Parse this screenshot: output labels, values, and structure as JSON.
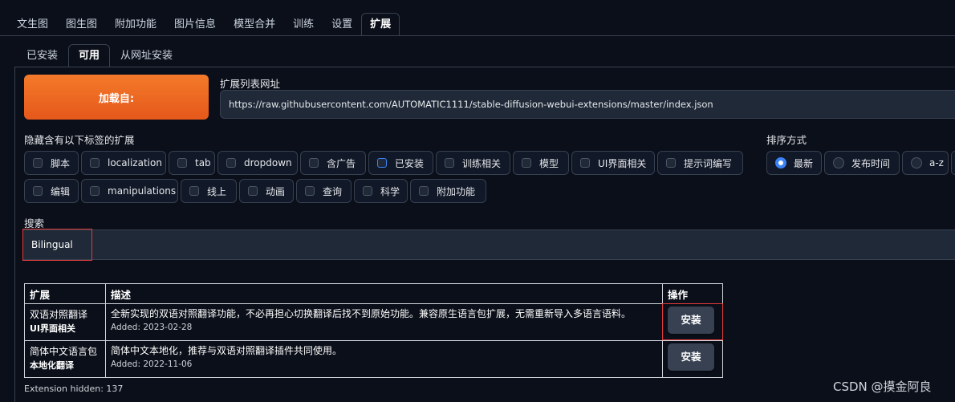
{
  "top_tabs": [
    "文生图",
    "图生图",
    "附加功能",
    "图片信息",
    "模型合并",
    "训练",
    "设置",
    "扩展"
  ],
  "sub_tabs": [
    "已安装",
    "可用",
    "从网址安装"
  ],
  "load_button": "加载自:",
  "url_label": "扩展列表网址",
  "url_value": "https://raw.githubusercontent.com/AUTOMATIC1111/stable-diffusion-webui-extensions/master/index.json",
  "hide_label": "隐藏含有以下标签的扩展",
  "tags": [
    "脚本",
    "localization",
    "tab",
    "dropdown",
    "含广告",
    "已安装",
    "训练相关",
    "模型",
    "UI界面相关",
    "提示词编写",
    "编辑",
    "manipulations",
    "线上",
    "动画",
    "查询",
    "科学",
    "附加功能"
  ],
  "sort_label": "排序方式",
  "sort_options": [
    "最新",
    "发布时间",
    "a-z"
  ],
  "search_label": "搜索",
  "search_value": "Bilingual",
  "table": {
    "headers": [
      "扩展",
      "描述",
      "操作"
    ],
    "rows": [
      {
        "name": "双语对照翻译",
        "tag": "UI界面相关",
        "desc": "全新实现的双语对照翻译功能，不必再担心切换翻译后找不到原始功能。兼容原生语言包扩展，无需重新导入多语言语料。",
        "added": "Added: 2023-02-28",
        "action": "安装"
      },
      {
        "name": "简体中文语言包",
        "tag": "本地化翻译",
        "desc": "简体中文本地化，推荐与双语对照翻译插件共同使用。",
        "added": "Added: 2022-11-06",
        "action": "安装"
      }
    ]
  },
  "hidden_count": "Extension hidden: 137",
  "watermark": "CSDN @摸金阿良"
}
